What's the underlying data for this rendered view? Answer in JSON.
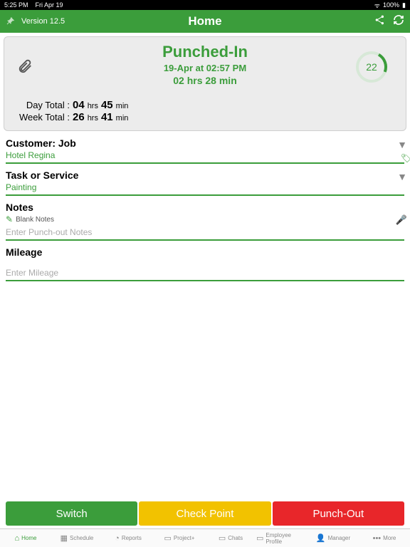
{
  "statusbar": {
    "time": "5:25 PM",
    "date": "Fri Apr 19",
    "battery": "100%"
  },
  "header": {
    "version": "Version 12.5",
    "title": "Home"
  },
  "status": {
    "title": "Punched-In",
    "datetime": "19-Apr at 02:57 PM",
    "duration": "02 hrs  28 min",
    "ring_value": "22",
    "day_label": "Day Total :",
    "day_hrs": "04",
    "day_hrs_unit": "hrs",
    "day_min": "45",
    "day_min_unit": "min",
    "week_label": "Week Total :",
    "week_hrs": "26",
    "week_hrs_unit": "hrs",
    "week_min": "41",
    "week_min_unit": "min"
  },
  "fields": {
    "customer_label": "Customer: Job",
    "customer_value": "Hotel Regina",
    "task_label": "Task or Service",
    "task_value": "Painting",
    "notes_label": "Notes",
    "notes_blank": "Blank Notes",
    "notes_placeholder": "Enter Punch-out Notes",
    "mileage_label": "Mileage",
    "mileage_placeholder": "Enter Mileage"
  },
  "buttons": {
    "switch": "Switch",
    "check": "Check Point",
    "punch": "Punch-Out"
  },
  "tabs": {
    "home": "Home",
    "schedule": "Schedule",
    "reports": "Reports",
    "project": "Project+",
    "chats": "Chats",
    "profile": "Employee Profile",
    "manager": "Manager",
    "more": "More"
  }
}
